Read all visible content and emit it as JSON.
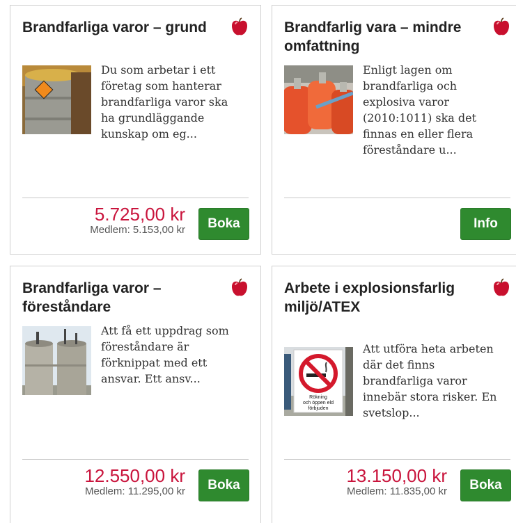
{
  "courses": [
    {
      "title": "Brandfarliga varor – grund",
      "description": "Du som arbetar i ett företag som hanterar brandfarliga varor ska ha grundläggande kunskap om eg...",
      "price": "5.725,00 kr",
      "member_price": "Medlem: 5.153,00 kr",
      "button_label": "Boka",
      "image_icon": "oil-drum-image"
    },
    {
      "title": "Brandfarlig vara – mindre omfattning",
      "description": "Enligt lagen om brandfarliga och explosiva varor (2010:1011) ska det finnas en eller flera föreståndare u...",
      "price": "",
      "member_price": "",
      "button_label": "Info",
      "image_icon": "gas-cylinders-image"
    },
    {
      "title": "Brandfarliga varor – föreståndare",
      "description": "Att få ett uppdrag som föreståndare är förknippat med ett ansvar. Ett ansv...",
      "price": "12.550,00 kr",
      "member_price": "Medlem: 11.295,00 kr",
      "button_label": "Boka",
      "image_icon": "silos-image"
    },
    {
      "title": "Arbete i explosionsfarlig miljö/ATEX",
      "description": "Att utföra heta arbeten där det finns brandfarliga varor innebär stora risker. En svetslop...",
      "price": "13.150,00 kr",
      "member_price": "Medlem: 11.835,00 kr",
      "button_label": "Boka",
      "image_icon": "no-smoking-sign-image",
      "sign_text": "Rökning och öppen eld förbjuden"
    }
  ],
  "colors": {
    "price": "#c9143c",
    "button": "#2f8a2f",
    "apple": "#c8102e"
  },
  "apple_icon": "apple-icon"
}
